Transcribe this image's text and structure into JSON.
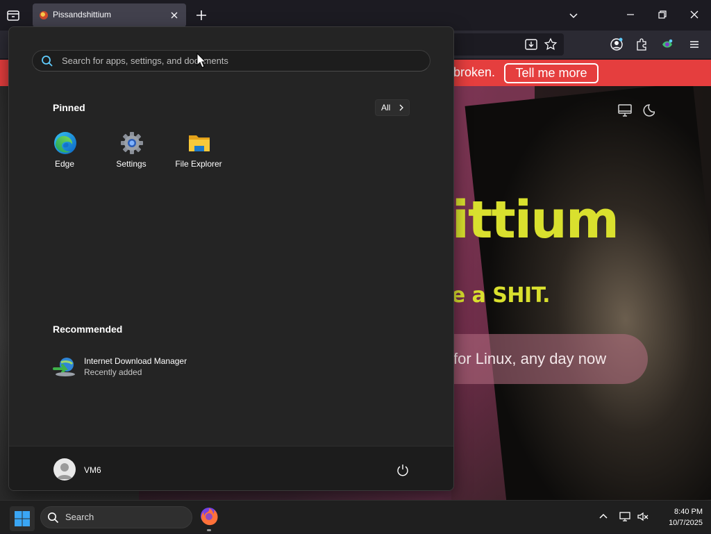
{
  "browser": {
    "tab": {
      "title": "Pissandshittium"
    },
    "notice": {
      "text": "broken.",
      "button_label": "Tell me more"
    }
  },
  "page": {
    "hero_title": "hittium",
    "hero_subtitle": "give a SHIT.",
    "hero_pill": "for Linux, any day now"
  },
  "start_menu": {
    "search": {
      "placeholder": "Search for apps, settings, and documents"
    },
    "pinned": {
      "title": "Pinned",
      "all_label": "All",
      "apps": [
        {
          "label": "Edge",
          "icon": "edge-icon"
        },
        {
          "label": "Settings",
          "icon": "settings-gear-icon"
        },
        {
          "label": "File Explorer",
          "icon": "folder-icon"
        }
      ]
    },
    "recommended": {
      "title": "Recommended",
      "items": [
        {
          "name": "Internet Download Manager",
          "sub": "Recently added",
          "icon": "idm-icon"
        }
      ]
    },
    "user": {
      "name": "VM6"
    }
  },
  "taskbar": {
    "search_label": "Search",
    "clock": {
      "time": "8:40 PM",
      "date": "10/7/2025"
    }
  },
  "colors": {
    "accent": "#60cdff",
    "notice_bg": "#e53e3e",
    "hero_yellow": "#d9e02e",
    "start_bg": "#242424"
  }
}
